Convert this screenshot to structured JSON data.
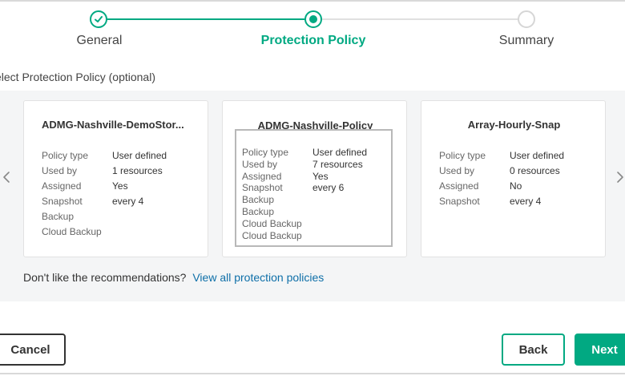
{
  "stepper": {
    "steps": [
      {
        "label": "General",
        "state": "complete"
      },
      {
        "label": "Protection Policy",
        "state": "active"
      },
      {
        "label": "Summary",
        "state": "pending"
      }
    ]
  },
  "section_label": "elect Protection Policy (optional)",
  "field_labels": {
    "policy_type": "Policy type",
    "used_by": "Used by",
    "assigned": "Assigned",
    "snapshot": "Snapshot",
    "backup": "Backup",
    "cloud_backup": "Cloud Backup"
  },
  "cards": [
    {
      "title": "ADMG-Nashville-DemoStor...",
      "policy_type": "User defined",
      "used_by": "1 resources",
      "assigned": "Yes",
      "snapshot": "every 4"
    },
    {
      "title": "ADMG-Nashville-Policy",
      "policy_type": "User defined",
      "used_by": "7 resources",
      "assigned": "Yes",
      "snapshot": "every 6"
    },
    {
      "title": "Array-Hourly-Snap",
      "policy_type": "User defined",
      "used_by": "0 resources",
      "assigned": "No",
      "snapshot": "every 4"
    }
  ],
  "recommendation": {
    "text": "Don't like the recommendations?",
    "link": "View all protection policies"
  },
  "buttons": {
    "cancel": "Cancel",
    "back": "Back",
    "next": "Next"
  },
  "icons": {
    "step_complete": "checkmark-icon",
    "carousel_prev": "chevron-left-icon",
    "carousel_next": "chevron-right-icon"
  },
  "colors": {
    "accent": "#01a982",
    "link": "#0e6fa8"
  }
}
